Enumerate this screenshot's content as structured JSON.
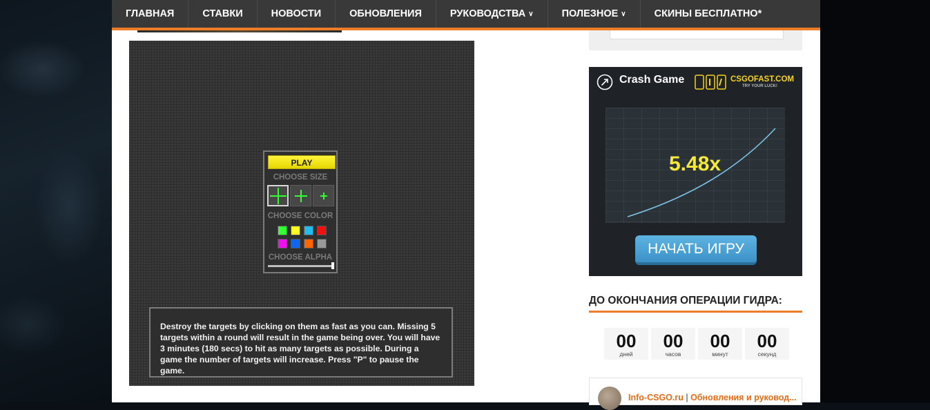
{
  "nav": {
    "items": [
      {
        "label": "ГЛАВНАЯ",
        "has_dropdown": false
      },
      {
        "label": "СТАВКИ",
        "has_dropdown": false
      },
      {
        "label": "НОВОСТИ",
        "has_dropdown": false
      },
      {
        "label": "ОБНОВЛЕНИЯ",
        "has_dropdown": false
      },
      {
        "label": "РУКОВОДСТВА",
        "has_dropdown": true
      },
      {
        "label": "ПОЛЕЗНОЕ",
        "has_dropdown": true
      },
      {
        "label": "СКИНЫ БЕСПЛАТНО*",
        "has_dropdown": false
      }
    ],
    "accent_color": "#ef7c26"
  },
  "game": {
    "play_label": "PLAY",
    "choose_size_label": "CHOOSE SIZE",
    "sizes": [
      "large",
      "medium",
      "small"
    ],
    "selected_size": "large",
    "choose_color_label": "CHOOSE COLOR",
    "colors": [
      "#33ff33",
      "#ffff22",
      "#22bbee",
      "#ee1111",
      "#ee11ee",
      "#1166ee",
      "#ff6600",
      "#999999"
    ],
    "choose_alpha_label": "CHOOSE ALPHA",
    "alpha_value": 1.0,
    "instructions": "Destroy the targets by clicking on them as fast as you can. Missing 5 targets within a round will result in the game being over. You will have 3 minutes (180 secs) to hit as many targets as possible. During a game the number of targets will increase. Press \"P\" to pause the game."
  },
  "ad": {
    "title": "Crash Game",
    "brand": "CSGOFAST.COM",
    "brand_sub": "TRY YOUR LUCK!",
    "multiplier": "5.48x",
    "cta": "НАЧАТЬ ИГРУ"
  },
  "countdown": {
    "title": "ДО ОКОНЧАНИЯ ОПЕРАЦИИ ГИДРА:",
    "units": [
      {
        "value": "00",
        "label": "дней"
      },
      {
        "value": "00",
        "label": "часов"
      },
      {
        "value": "00",
        "label": "минут"
      },
      {
        "value": "00",
        "label": "секунд"
      }
    ]
  },
  "widget": {
    "site": "Info-CSGO.ru",
    "separator": " | ",
    "description": "Обновления и руковод..."
  }
}
